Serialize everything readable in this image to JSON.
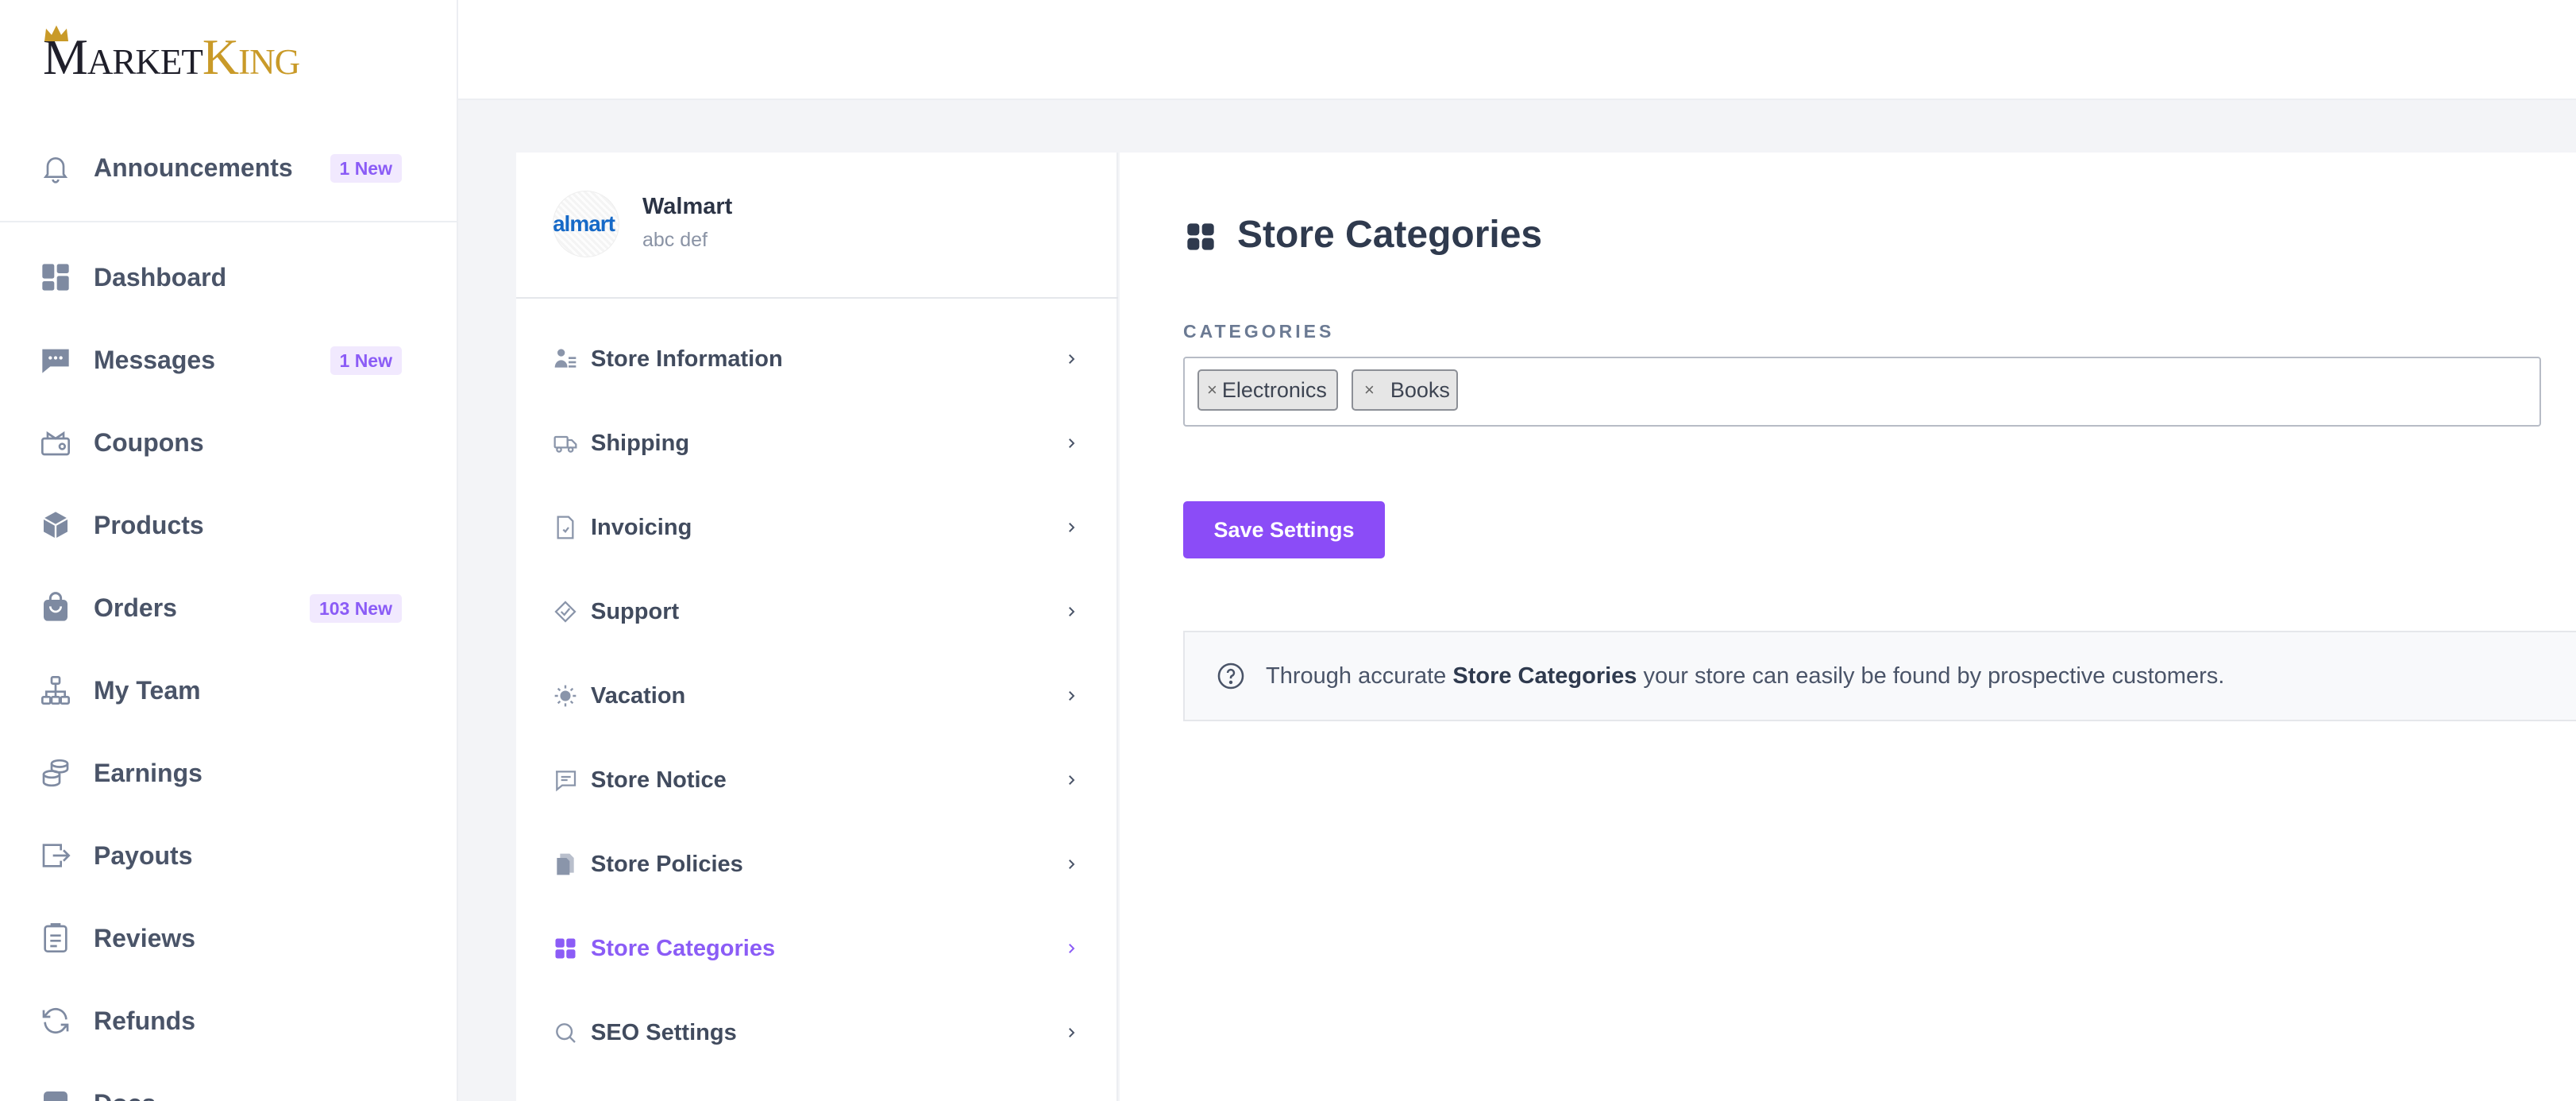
{
  "brand": {
    "name_part1": "Market",
    "name_part2": "King"
  },
  "sidebar": {
    "announcements": {
      "label": "Announcements",
      "badge": "1 New"
    },
    "items": [
      {
        "label": "Dashboard",
        "icon": "dashboard-icon",
        "badge": ""
      },
      {
        "label": "Messages",
        "icon": "messages-icon",
        "badge": "1 New"
      },
      {
        "label": "Coupons",
        "icon": "coupons-icon",
        "badge": ""
      },
      {
        "label": "Products",
        "icon": "products-icon",
        "badge": ""
      },
      {
        "label": "Orders",
        "icon": "orders-icon",
        "badge": "103 New"
      },
      {
        "label": "My Team",
        "icon": "team-icon",
        "badge": ""
      },
      {
        "label": "Earnings",
        "icon": "earnings-icon",
        "badge": ""
      },
      {
        "label": "Payouts",
        "icon": "payouts-icon",
        "badge": ""
      },
      {
        "label": "Reviews",
        "icon": "reviews-icon",
        "badge": ""
      },
      {
        "label": "Refunds",
        "icon": "refunds-icon",
        "badge": ""
      },
      {
        "label": "Docs",
        "icon": "docs-icon",
        "badge": ""
      }
    ]
  },
  "store": {
    "logo_text": "almart",
    "name": "Walmart",
    "subtitle": "abc def"
  },
  "settings_menu": [
    {
      "label": "Store Information",
      "icon": "store-info-icon"
    },
    {
      "label": "Shipping",
      "icon": "truck-icon"
    },
    {
      "label": "Invoicing",
      "icon": "invoice-icon"
    },
    {
      "label": "Support",
      "icon": "support-icon"
    },
    {
      "label": "Vacation",
      "icon": "sun-icon"
    },
    {
      "label": "Store Notice",
      "icon": "notice-icon"
    },
    {
      "label": "Store Policies",
      "icon": "policies-icon"
    },
    {
      "label": "Store Categories",
      "icon": "categories-icon",
      "active": true
    },
    {
      "label": "SEO Settings",
      "icon": "search-icon"
    }
  ],
  "content": {
    "title": "Store Categories",
    "field_label": "CATEGORIES",
    "tag_remove": "×",
    "tags": [
      "Electronics",
      "Books"
    ],
    "save_label": "Save Settings",
    "info": {
      "prefix": "Through accurate ",
      "bold": "Store Categories",
      "suffix": " your store can easily be found by prospective customers."
    }
  },
  "colors": {
    "accent": "#8b4cf7",
    "badge_bg": "#f1e9fe",
    "badge_text": "#8b5cf6",
    "brand_gold": "#c99a28"
  }
}
